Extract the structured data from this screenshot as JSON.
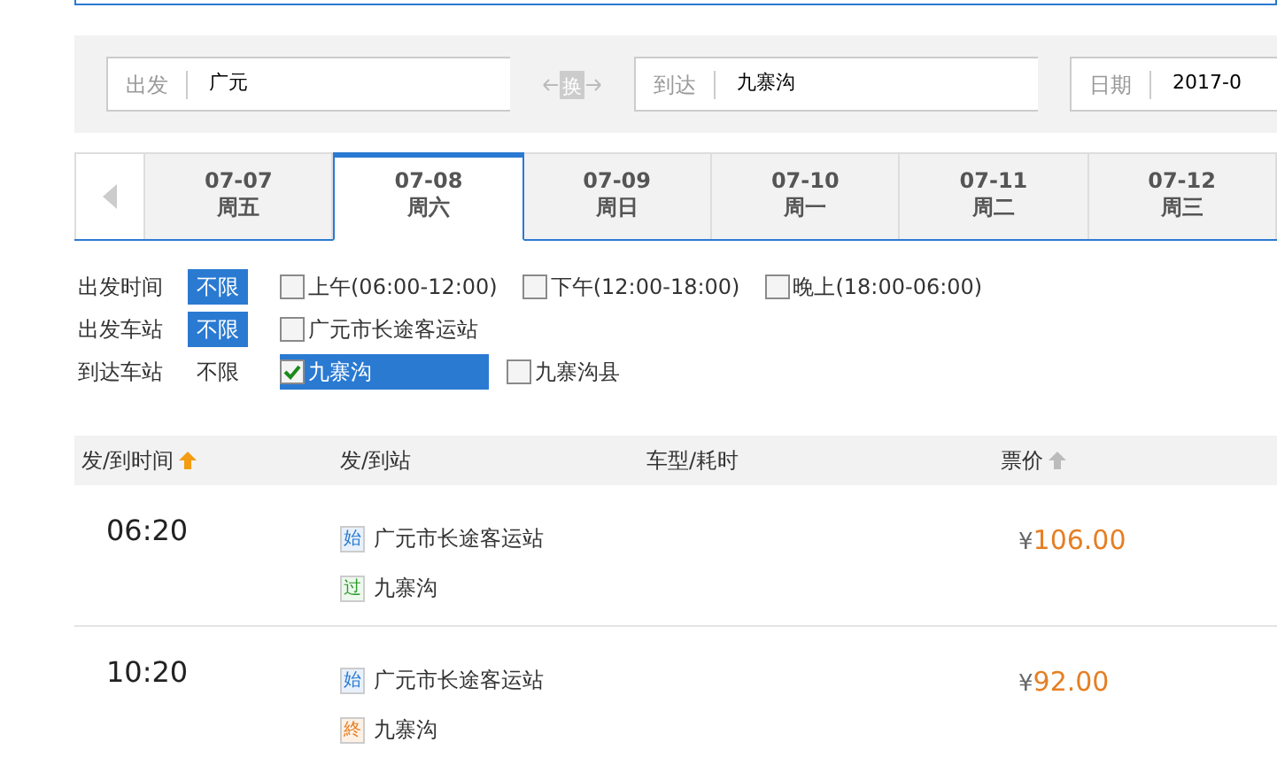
{
  "search": {
    "fields": [
      {
        "label": "出发",
        "value": "广元"
      },
      {
        "label": "到达",
        "value": "九寨沟"
      },
      {
        "label": "日期",
        "value": "2017-0"
      }
    ],
    "swap": "换"
  },
  "date_tabs": [
    {
      "date": "07-07",
      "weekday": "周五",
      "selected": false
    },
    {
      "date": "07-08",
      "weekday": "周六",
      "selected": true
    },
    {
      "date": "07-09",
      "weekday": "周日",
      "selected": false
    },
    {
      "date": "07-10",
      "weekday": "周一",
      "selected": false
    },
    {
      "date": "07-11",
      "weekday": "周二",
      "selected": false
    },
    {
      "date": "07-12",
      "weekday": "周三",
      "selected": false
    }
  ],
  "filters": [
    {
      "label": "出发时间",
      "any": {
        "text": "不限",
        "selected": true
      },
      "options": [
        {
          "text": "上午(06:00-12:00)",
          "checked": false
        },
        {
          "text": "下午(12:00-18:00)",
          "checked": false
        },
        {
          "text": "晚上(18:00-06:00)",
          "checked": false
        }
      ]
    },
    {
      "label": "出发车站",
      "any": {
        "text": "不限",
        "selected": true
      },
      "options": [
        {
          "text": "广元市长途客运站",
          "checked": false
        }
      ]
    },
    {
      "label": "到达车站",
      "any": {
        "text": "不限",
        "selected": false
      },
      "options": [
        {
          "text": "九寨沟",
          "checked": true
        },
        {
          "text": "九寨沟县",
          "checked": false
        }
      ]
    }
  ],
  "table": {
    "columns": [
      {
        "label": "发/到时间",
        "sorted": true
      },
      {
        "label": "发/到站"
      },
      {
        "label": "车型/耗时"
      },
      {
        "label": "票价",
        "sorted": false
      }
    ],
    "rows": [
      {
        "time": "06:20",
        "stops": [
          {
            "kind": "start",
            "tag": "始",
            "name": "广元市长途客运站"
          },
          {
            "kind": "pass",
            "tag": "过",
            "name": "九寨沟"
          }
        ],
        "currency": "¥",
        "price": "106.00"
      },
      {
        "time": "10:20",
        "stops": [
          {
            "kind": "start",
            "tag": "始",
            "name": "广元市长途客运站"
          },
          {
            "kind": "end",
            "tag": "終",
            "name": "九寨沟"
          }
        ],
        "currency": "¥",
        "price": "92.00"
      }
    ]
  }
}
